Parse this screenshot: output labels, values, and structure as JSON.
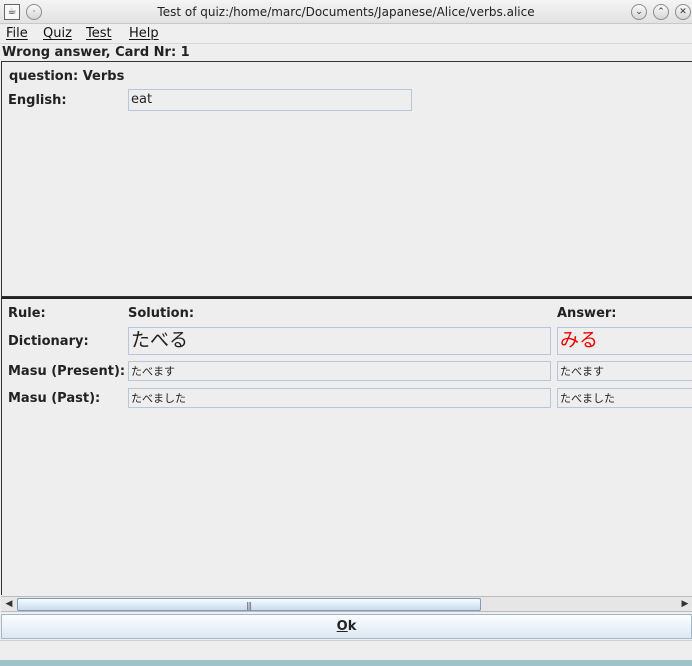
{
  "window": {
    "title": "Test of quiz:/home/marc/Documents/Japanese/Alice/verbs.alice",
    "app_icon": "java-icon",
    "buttons": [
      "minimize-icon",
      "maximize-icon",
      "close-icon"
    ]
  },
  "menu": {
    "items": [
      {
        "label": "File"
      },
      {
        "label": "Quiz"
      },
      {
        "label": "Test"
      },
      {
        "label": "Help"
      }
    ]
  },
  "status_message": "Wrong answer, Card Nr: 1",
  "question": {
    "heading": "question: Verbs",
    "english_label": "English:",
    "english_value": "eat"
  },
  "solution": {
    "headers": {
      "rule": "Rule:",
      "solution": "Solution:",
      "answer": "Answer:"
    },
    "rows": [
      {
        "rule": "Dictionary:",
        "solution": "たべる",
        "answer": "みる",
        "answer_correct": false
      },
      {
        "rule": "Masu (Present):",
        "solution": "たべます",
        "answer": "たべます",
        "answer_correct": true
      },
      {
        "rule": "Masu (Past):",
        "solution": "たべました",
        "answer": "たべました",
        "answer_correct": true
      }
    ]
  },
  "buttons": {
    "ok_label_underlined": "O",
    "ok_label_rest": "k"
  },
  "colors": {
    "wrong_answer": "#e80000",
    "background": "#eeeeee"
  }
}
